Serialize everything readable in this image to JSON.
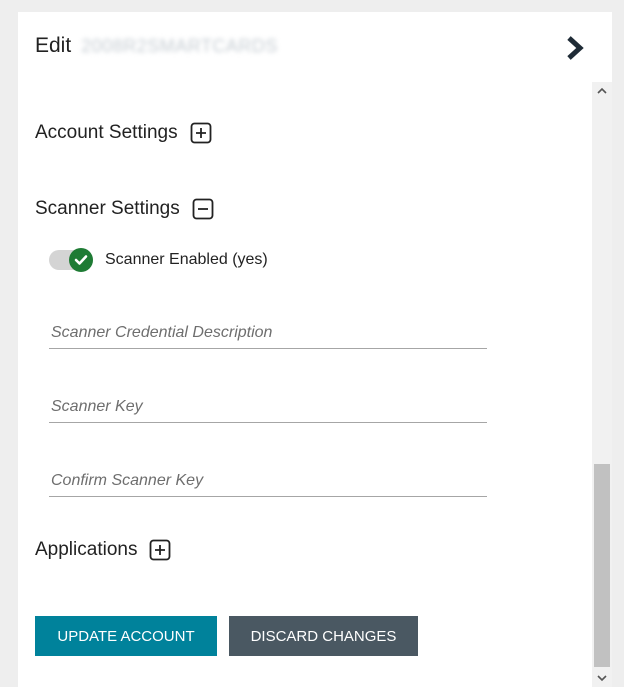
{
  "header": {
    "edit_label": "Edit",
    "item_name": "2008R2SMARTCARDS",
    "collapse_icon": "chevron-right-icon"
  },
  "sections": {
    "account": {
      "label": "Account Settings",
      "icon": "expand-plus-icon"
    },
    "scanner": {
      "label": "Scanner Settings",
      "icon": "collapse-minus-icon"
    },
    "applications": {
      "label": "Applications",
      "icon": "expand-plus-icon"
    }
  },
  "scanner": {
    "toggle_label": "Scanner Enabled (yes)",
    "toggle_on": true,
    "accent_color": "#1e7b34",
    "fields": {
      "description": {
        "value": "",
        "placeholder": "Scanner Credential Description"
      },
      "key": {
        "value": "",
        "placeholder": "Scanner Key"
      },
      "confirm_key": {
        "value": "",
        "placeholder": "Confirm Scanner Key"
      }
    }
  },
  "actions": {
    "update_label": "UPDATE ACCOUNT",
    "update_color": "#00829b",
    "discard_label": "DISCARD CHANGES",
    "discard_color": "#4a5862"
  }
}
